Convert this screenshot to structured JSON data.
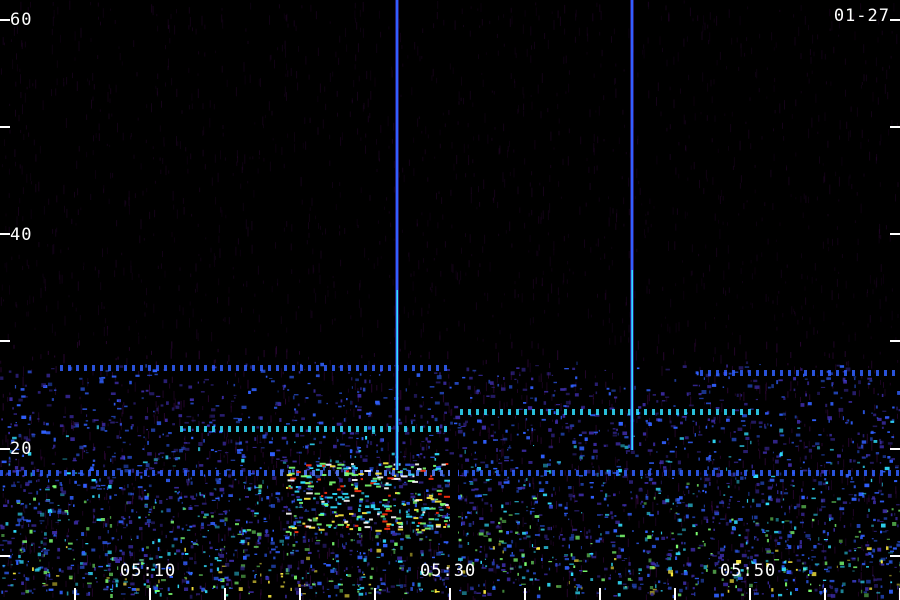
{
  "header": {
    "date": "01-27"
  },
  "y_axis": {
    "labels": [
      "60",
      "40",
      "20"
    ],
    "values": [
      60,
      40,
      20
    ],
    "minor_values": [
      50,
      30,
      10
    ]
  },
  "x_axis": {
    "labels": [
      "05:10",
      "05:30",
      "05:50"
    ]
  },
  "colors": {
    "background": "#000000",
    "noise": "#4a0a5a",
    "low": "#3a2aa0",
    "mid": "#3060ff",
    "cyan": "#30e0ff",
    "green": "#7cff70",
    "yellow": "#ffee40",
    "red": "#ff3010",
    "white": "#ffffff",
    "axis": "#ffffff"
  }
}
